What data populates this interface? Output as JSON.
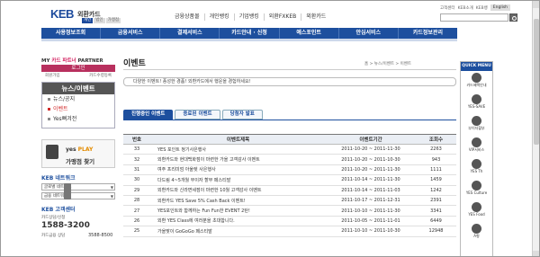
{
  "header": {
    "logo_brand": "KEB",
    "logo_sub": "외환카드",
    "logo_tabs": [
      "개인",
      "법인",
      "가맹점"
    ],
    "topmenu": [
      "금융상품몰",
      "개인뱅킹",
      "기업뱅킹",
      "외환FXKEB",
      "외환카드"
    ],
    "utility": [
      "고객센터",
      "KEB소개",
      "KEB뱅",
      "English"
    ]
  },
  "gnb": [
    "사용정보조회",
    "금융서비스",
    "결제서비스",
    "카드안내 · 신청",
    "예스포인트",
    "안심서비스",
    "카드정보관리"
  ],
  "sidebar": {
    "partner_label": "MY",
    "partner_mid": "카드 파트너",
    "partner_end": "PARTNER",
    "login_label": "로그인",
    "login_sub": [
      "회원가입",
      "카드수령등록"
    ],
    "news_title": "뉴스/이벤트",
    "news_items": [
      "뉴스/공지",
      "이벤트",
      "Yes뻐겨전"
    ],
    "yes_label": "yes",
    "yes_label2": "PLAY",
    "yes_text": "가맹점 찾기",
    "network_title": "KEB 네트워크",
    "network_selects": [
      "글로벌 네트워크",
      "금융 네트워크"
    ],
    "customer_title": "KEB 고객센터",
    "phone_label1": "카드상담/신청",
    "phone_num": "1588-3200",
    "phone_label2": "카드금융 상담",
    "phone_num2": "3588-8500"
  },
  "main": {
    "breadcrumb": "홈 > 뉴스/이벤트 > 이벤트",
    "title": "이벤트",
    "notice": "다양한 이벤트! 풍성한 경품! 외환카드에서 행운을 경험하세요!",
    "tabs": [
      "진행중인 이벤트",
      "종료된 이벤트",
      "당첨자 발표"
    ],
    "table_headers": [
      "번호",
      "이벤트제목",
      "이벤트기간",
      "조회수"
    ],
    "rows": [
      {
        "num": "33",
        "title": "YES 포인트 정기사은행사",
        "period": "2011-10-20 ~ 2011-11-30",
        "count": "2263"
      },
      {
        "num": "32",
        "title": "외환카드와 현대백화점이 마련한 가을 고객감사 이벤트",
        "period": "2011-10-20 ~ 2011-10-30",
        "count": "943"
      },
      {
        "num": "31",
        "title": "여주 프리미엄 아울렛 사은행사",
        "period": "2011-10-20 ~ 2011-11-30",
        "count": "1111"
      },
      {
        "num": "30",
        "title": "다드림 4~5개월 무이자 할부 페스티발",
        "period": "2011-10-14 ~ 2011-11-30",
        "count": "1459"
      },
      {
        "num": "29",
        "title": "외환카드와 신라면세점이 마련한 10월 고객감사 이벤트",
        "period": "2011-10-14 ~ 2011-11-03",
        "count": "1242"
      },
      {
        "num": "28",
        "title": "외환카드 YES Save 5% Cash Back 이벤트!",
        "period": "2011-10-17 ~ 2011-12-31",
        "count": "2391"
      },
      {
        "num": "27",
        "title": "YES포인트와 함께하는 Fun Fun한 EVENT 2탄!",
        "period": "2011-10-10 ~ 2011-11-30",
        "count": "3341"
      },
      {
        "num": "26",
        "title": "외환 YES Class에 여러분을 초대합니다.",
        "period": "2011-10-05 ~ 2011-11-01",
        "count": "6449"
      },
      {
        "num": "25",
        "title": "가을맞이 GoGoGo 페스티발",
        "period": "2011-10-10 ~ 2011-10-30",
        "count": "12948"
      }
    ]
  },
  "quick_menu": {
    "title": "QUICK MENU",
    "items": [
      "카드혜택안내",
      "YES-SAVE",
      "부이자할부",
      "VIP서비스",
      "YES Th",
      "YES Culture",
      "YES Food",
      "A형"
    ]
  }
}
